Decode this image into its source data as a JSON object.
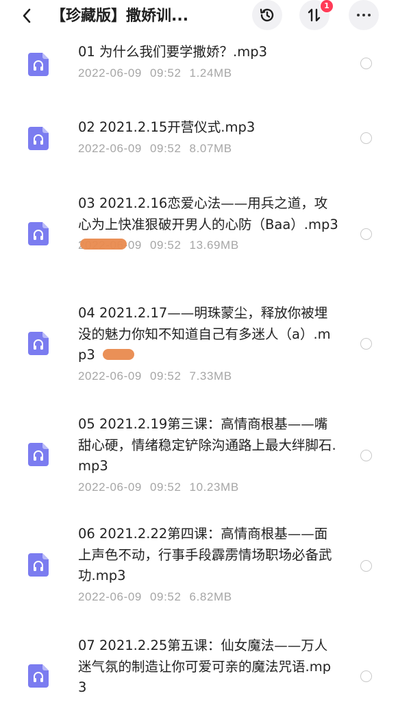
{
  "header": {
    "title": "【珍藏版】撒娇训...",
    "notification_count": "1",
    "icons": {
      "back": "chevron-left-icon",
      "history": "history-icon",
      "sort": "sort-icon",
      "more": "more-icon"
    }
  },
  "files": [
    {
      "name": "01 为什么我们要学撒娇？.mp3",
      "date": "2022-06-09",
      "time": "09:52",
      "size": "1.24MB",
      "icon": "audio-file-icon"
    },
    {
      "name": "02 2021.2.15开营仪式.mp3",
      "date": "2022-06-09",
      "time": "09:52",
      "size": "8.07MB",
      "icon": "audio-file-icon"
    },
    {
      "name": "03 2021.2.16恋爱心法——用兵之道，攻心为上快准狠破开男人的心防（Ba⁠a）.mp3",
      "date": "2022-06-09",
      "time": "09:52",
      "size": "13.69MB",
      "icon": "audio-file-icon"
    },
    {
      "name": "04 2021.2.17——明珠蒙尘，释放你被埋没的魅力你知不知道自己有多迷人（⁠a）.mp3",
      "date": "2022-06-09",
      "time": "09:52",
      "size": "7.33MB",
      "icon": "audio-file-icon"
    },
    {
      "name": "05 2021.2.19第三课：高情商根基——嘴甜心硬，情绪稳定铲除沟通路上最大绊脚石.mp3",
      "date": "2022-06-09",
      "time": "09:52",
      "size": "10.23MB",
      "icon": "audio-file-icon"
    },
    {
      "name": "06 2021.2.22第四课：高情商根基——面上声色不动，行事手段霹雳情场职场必备武功.mp3",
      "date": "2022-06-09",
      "time": "09:52",
      "size": "6.82MB",
      "icon": "audio-file-icon"
    },
    {
      "name": "07 2021.2.25第五课：仙女魔法——万人迷气氛的制造让你可爱可亲的魔法咒语.mp3",
      "date": "",
      "time": "",
      "size": "",
      "icon": "audio-file-icon"
    }
  ],
  "colors": {
    "icon_purple": "#7b7cf0",
    "text_primary": "#222222",
    "text_meta": "#a6a6a6",
    "badge_red": "#ff3b57"
  }
}
